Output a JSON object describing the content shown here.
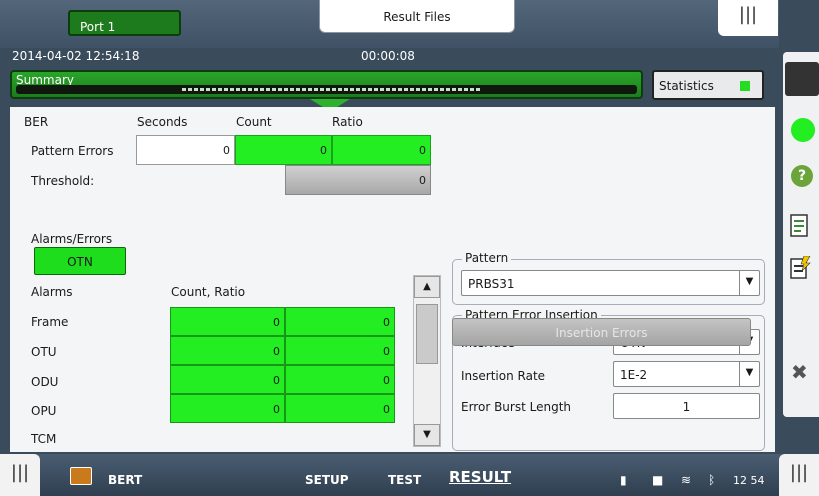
{
  "header": {
    "port_tab": "Port 1",
    "result_files_tab": "Result Files",
    "datetime": "2014-04-02 12:54:18",
    "elapsed": "00:00:08",
    "top_grip_icon": "|||"
  },
  "summary": {
    "label": "Summary",
    "statistics_button": "Statistics",
    "status_color": "#22dd22"
  },
  "ber": {
    "title": "BER",
    "col_seconds": "Seconds",
    "col_count": "Count",
    "col_ratio": "Ratio",
    "pattern_errors_label": "Pattern Errors",
    "pattern_errors_seconds": "0",
    "pattern_errors_count": "0",
    "pattern_errors_ratio": "0",
    "threshold_label": "Threshold:",
    "threshold_value": "0"
  },
  "alarms": {
    "section_label": "Alarms/Errors",
    "otn_button": "OTN",
    "col_alarms": "Alarms",
    "col_count_ratio": "Count, Ratio",
    "rows": [
      {
        "label": "Frame",
        "count": "0",
        "ratio": "0"
      },
      {
        "label": "OTU",
        "count": "0",
        "ratio": "0"
      },
      {
        "label": "ODU",
        "count": "0",
        "ratio": "0"
      },
      {
        "label": "OPU",
        "count": "0",
        "ratio": "0"
      },
      {
        "label": "TCM"
      }
    ]
  },
  "pattern": {
    "title": "Pattern",
    "selected": "PRBS31"
  },
  "insertion": {
    "title": "Pattern Error Insertion",
    "interface_label": "Interface",
    "interface_value": "OTN",
    "rate_label": "Insertion Rate",
    "rate_value": "1E-2",
    "burst_label": "Error Burst Length",
    "burst_value": "1",
    "button": "Insertion Errors"
  },
  "sidebar": {
    "help_glyph": "?",
    "close_glyph": "✖"
  },
  "bottombar": {
    "app_name": "BERT",
    "setup": "SETUP",
    "test": "TEST",
    "result": "RESULT",
    "time": "12 54",
    "left_grip": "|||",
    "right_grip": "|||"
  }
}
